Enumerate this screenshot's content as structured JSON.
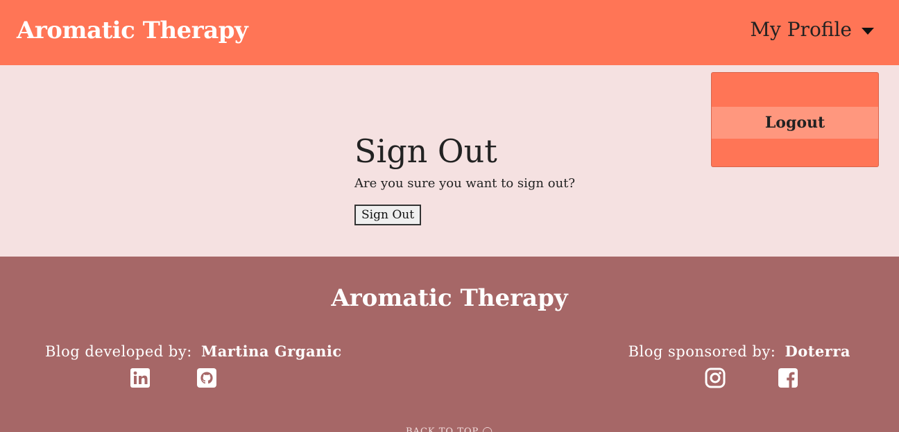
{
  "navbar": {
    "brand": "Aromatic Therapy",
    "profile_label": "My Profile"
  },
  "dropdown": {
    "items": [
      {
        "label": "Logout"
      }
    ]
  },
  "main": {
    "title": "Sign Out",
    "prompt": "Are you sure you want to sign out?",
    "button_label": "Sign Out"
  },
  "footer": {
    "brand": "Aromatic Therapy",
    "developed_by_label": "Blog developed by:",
    "developer_name": "Martina Grganic",
    "sponsored_by_label": "Blog sponsored by:",
    "sponsor_name": "Doterra",
    "icons": [
      "linkedin-icon",
      "github-icon",
      "instagram-icon",
      "facebook-icon"
    ],
    "back_to_top": "BACK TO TOP"
  },
  "colors": {
    "navbar": "#ff7556",
    "dropdown_active": "#ff977e",
    "page_background": "#f5e1e1",
    "footer": "#a66767"
  }
}
